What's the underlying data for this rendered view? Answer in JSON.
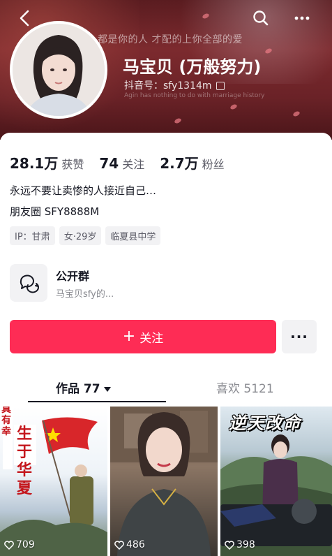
{
  "header": {
    "bg_quote": "都是你的人 才配的上你全部的爱",
    "bg_subtitle": "Agin has nothing to do with marriage history",
    "name": "马宝贝 (万般努力)",
    "account": "抖音号：sfy1314m"
  },
  "stats": [
    {
      "value": "28.1万",
      "label": "获赞"
    },
    {
      "value": "74",
      "label": "关注"
    },
    {
      "value": "2.7万",
      "label": "粉丝"
    }
  ],
  "bio": {
    "line1": "永远不要让卖惨的人接近自己…",
    "line2": "朋友圈 SFY8888M"
  },
  "tags": [
    "IP：甘肃",
    "女·29岁",
    "临夏县中学"
  ],
  "group": {
    "title": "公开群",
    "subtitle": "马宝贝sfy的..."
  },
  "actions": {
    "follow_label": "关注",
    "more_label": "···"
  },
  "tabs": {
    "works": "作品 77",
    "likes": "喜欢 5121"
  },
  "videos": [
    {
      "likes": "709",
      "overlay_text_1": "真有幸",
      "overlay_text_2": "生于华夏"
    },
    {
      "likes": "486"
    },
    {
      "likes": "398",
      "overlay_text": "逆天改命"
    }
  ],
  "colors": {
    "accent": "#fe2c55",
    "text": "#161823",
    "muted": "#8a8b91"
  }
}
